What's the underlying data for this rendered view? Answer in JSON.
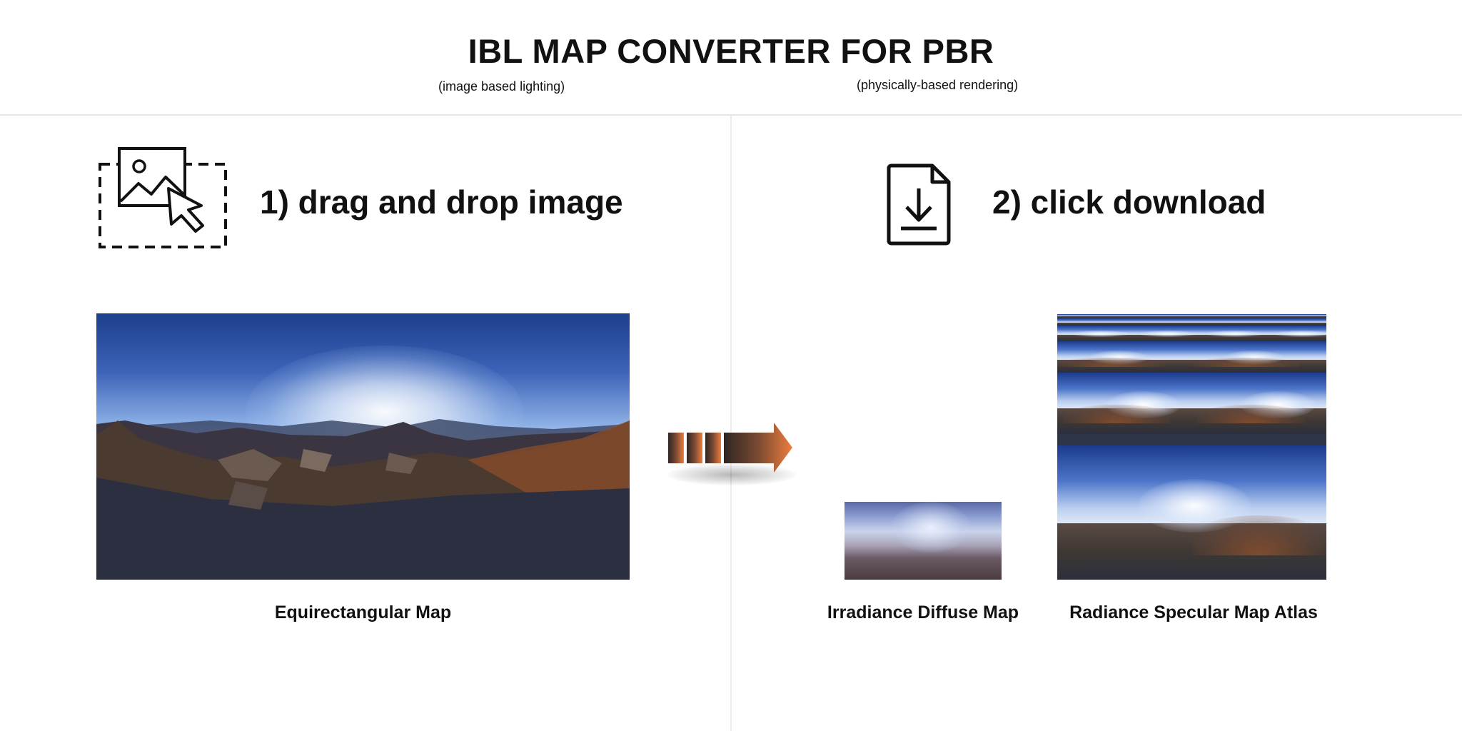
{
  "header": {
    "title": "IBL MAP CONVERTER FOR PBR",
    "note_left": "(image based lighting)",
    "note_right": "(physically-based rendering)"
  },
  "steps": {
    "step1_label": "1) drag and drop image",
    "step1_icon": "image-upload-drop-icon",
    "step2_label": "2) click download",
    "step2_icon": "download-file-icon"
  },
  "maps": {
    "equirect_caption": "Equirectangular Map",
    "irradiance_caption": "Irradiance Diffuse Map",
    "radiance_caption": "Radiance Specular Map Atlas"
  },
  "arrow": {
    "icon": "conversion-arrow-icon",
    "color": "#e8773a"
  },
  "colors": {
    "text": "#111111",
    "divider": "#ececec",
    "accent": "#e8773a"
  }
}
